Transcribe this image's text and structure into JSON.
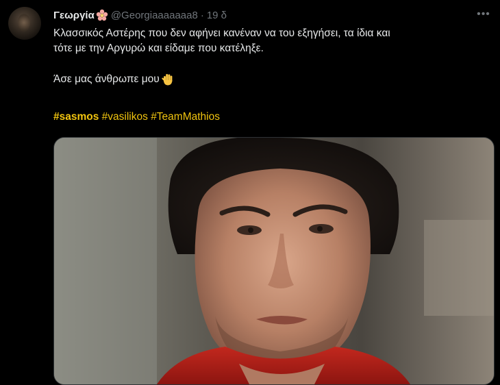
{
  "tweet": {
    "display_name": "Γεωργία",
    "handle": "@Georgiaaaaaaa8",
    "separator": "·",
    "time": "19 δ",
    "more_label": "•••",
    "text_line1": "Κλασσικός Αστέρης που δεν αφήνει κανέναν να του εξηγήσει, τα ίδια και",
    "text_line2": "τότε με την Αργυρώ και είδαμε που κατέληξε.",
    "text_para2": "Άσε μας άνθρωπε μου",
    "hashtags": [
      "#sasmos",
      "#vasilikos",
      "#TeamMathios"
    ],
    "icons": {
      "name_badge": "flower-icon",
      "emoji": "raised-hand-icon",
      "menu": "more-options-icon"
    },
    "colors": {
      "background": "#000000",
      "text": "#e7e9ea",
      "secondary": "#71767b",
      "hashtag": "#f1c40f"
    }
  }
}
